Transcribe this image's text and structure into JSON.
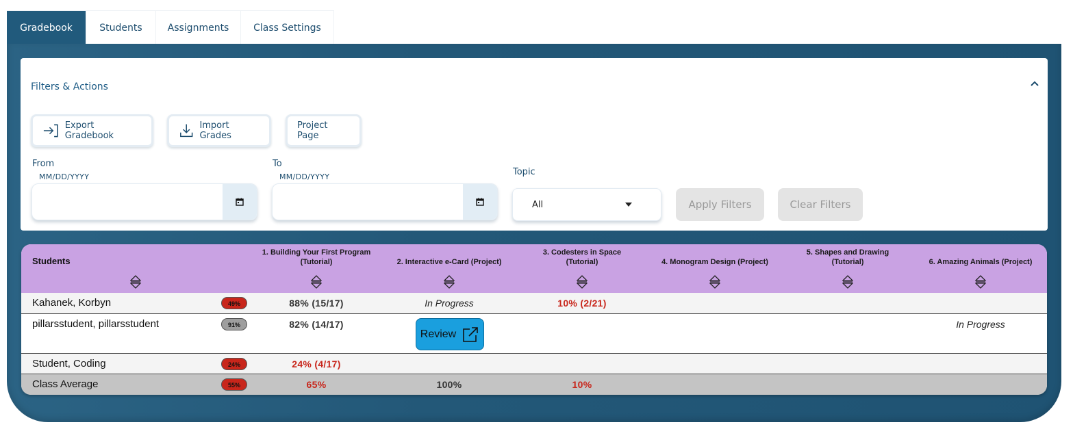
{
  "tabs": [
    "Gradebook",
    "Students",
    "Assignments",
    "Class Settings"
  ],
  "filters": {
    "title": "Filters & Actions",
    "buttons": {
      "export": "Export Gradebook",
      "import": "Import Grades",
      "project": "Project Page"
    },
    "from_label": "From",
    "to_label": "To",
    "date_hint": "MM/DD/YYYY",
    "from_value": "",
    "to_value": "",
    "topic_label": "Topic",
    "topic_value": "All",
    "apply": "Apply Filters",
    "clear": "Clear Filters"
  },
  "gradebook": {
    "students_header": "Students",
    "assignments": [
      {
        "line1": "1. Building Your First Program",
        "line2": "(Tutorial)"
      },
      {
        "line1": "2. Interactive e-Card (Project)",
        "line2": ""
      },
      {
        "line1": "3. Codesters in Space",
        "line2": "(Tutorial)"
      },
      {
        "line1": "4. Monogram Design (Project)",
        "line2": ""
      },
      {
        "line1": "5. Shapes and Drawing",
        "line2": "(Tutorial)"
      },
      {
        "line1": "6. Amazing Animals (Project)",
        "line2": ""
      }
    ],
    "rows": [
      {
        "name": "Kahanek, Korbyn",
        "overall": "49%",
        "a1": "88%  (15/17)",
        "a2": "In Progress",
        "a3": "10%  (2/21)"
      },
      {
        "name": "pillarsstudent, pillarsstudent",
        "overall": "91%",
        "a1": "82%  (14/17)",
        "a2_button": "Review",
        "a6": "In Progress"
      },
      {
        "name": "Student, Coding",
        "overall": "24%",
        "a1": "24%  (4/17)"
      }
    ],
    "average": {
      "name": "Class Average",
      "overall": "55%",
      "a1": "65%",
      "a2": "100%",
      "a3": "10%"
    }
  },
  "colors": {
    "tab_active": "#215a7c",
    "header_purple": "#c9a2e3",
    "grade_red": "#c8261b",
    "review_blue": "#1a9fde"
  },
  "icons": [
    "chevron-up-icon",
    "export-icon",
    "import-icon",
    "calendar-icon",
    "caret-down-icon",
    "sort-icon",
    "external-link-icon"
  ]
}
